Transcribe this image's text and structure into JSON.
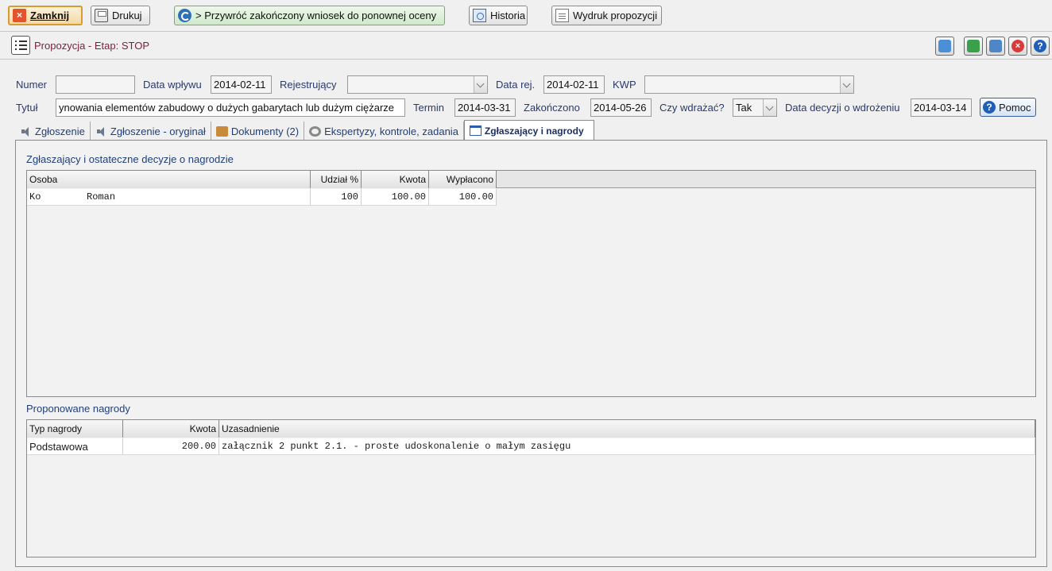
{
  "toolbar": {
    "close_label": "Zamknij",
    "print_label": "Drukuj",
    "restore_label": "> Przywróć zakończony wniosek do ponownej oceny",
    "history_label": "Historia",
    "printout_label": "Wydruk propozycji"
  },
  "titlebar": {
    "title": "Propozycja - Etap: STOP"
  },
  "form": {
    "numer_label": "Numer",
    "numer_value": "",
    "data_wplywu_label": "Data wpływu",
    "data_wplywu_value": "2014-02-11",
    "rejestrujacy_label": "Rejestrujący",
    "rejestrujacy_value": "",
    "data_rej_label": "Data rej.",
    "data_rej_value": "2014-02-11",
    "kwp_label": "KWP",
    "kwp_value": "",
    "tytul_label": "Tytuł",
    "tytul_value": "ynowania elementów zabudowy o dużych gabarytach lub dużym ciężarze",
    "termin_label": "Termin",
    "termin_value": "2014-03-31",
    "zakonczono_label": "Zakończono",
    "zakonczono_value": "2014-05-26",
    "czy_wdrazac_label": "Czy wdrażać?",
    "czy_wdrazac_value": "Tak",
    "data_decyzji_label": "Data decyzji o wdrożeniu",
    "data_decyzji_value": "2014-03-14",
    "help_label": "Pomoc"
  },
  "tabs": [
    {
      "label": "Zgłoszenie",
      "icon": "speaker-icon"
    },
    {
      "label": "Zgłoszenie - oryginał",
      "icon": "speaker-icon"
    },
    {
      "label": "Dokumenty (2)",
      "icon": "folder-icon"
    },
    {
      "label": "Ekspertyzy, kontrole, zadania",
      "icon": "gear-icon"
    },
    {
      "label": "Zgłaszający i nagrody",
      "icon": "window-icon",
      "active": true
    }
  ],
  "applicants": {
    "section_title": "Zgłaszający i ostateczne decyzje o nagrodzie",
    "columns": [
      "Osoba",
      "Udział %",
      "Kwota",
      "Wypłacono"
    ],
    "rows": [
      {
        "osoba": "Ko        Roman",
        "udzial": "100",
        "kwota": "100.00",
        "wyplacono": "100.00"
      }
    ]
  },
  "awards": {
    "section_title": "Proponowane nagrody",
    "columns": [
      "Typ nagrody",
      "Kwota",
      "Uzasadnienie"
    ],
    "rows": [
      {
        "typ": "Podstawowa",
        "kwota": "200.00",
        "uzasadnienie": "załącznik 2 punkt 2.1. - proste udoskonalenie o małym zasięgu"
      }
    ]
  }
}
